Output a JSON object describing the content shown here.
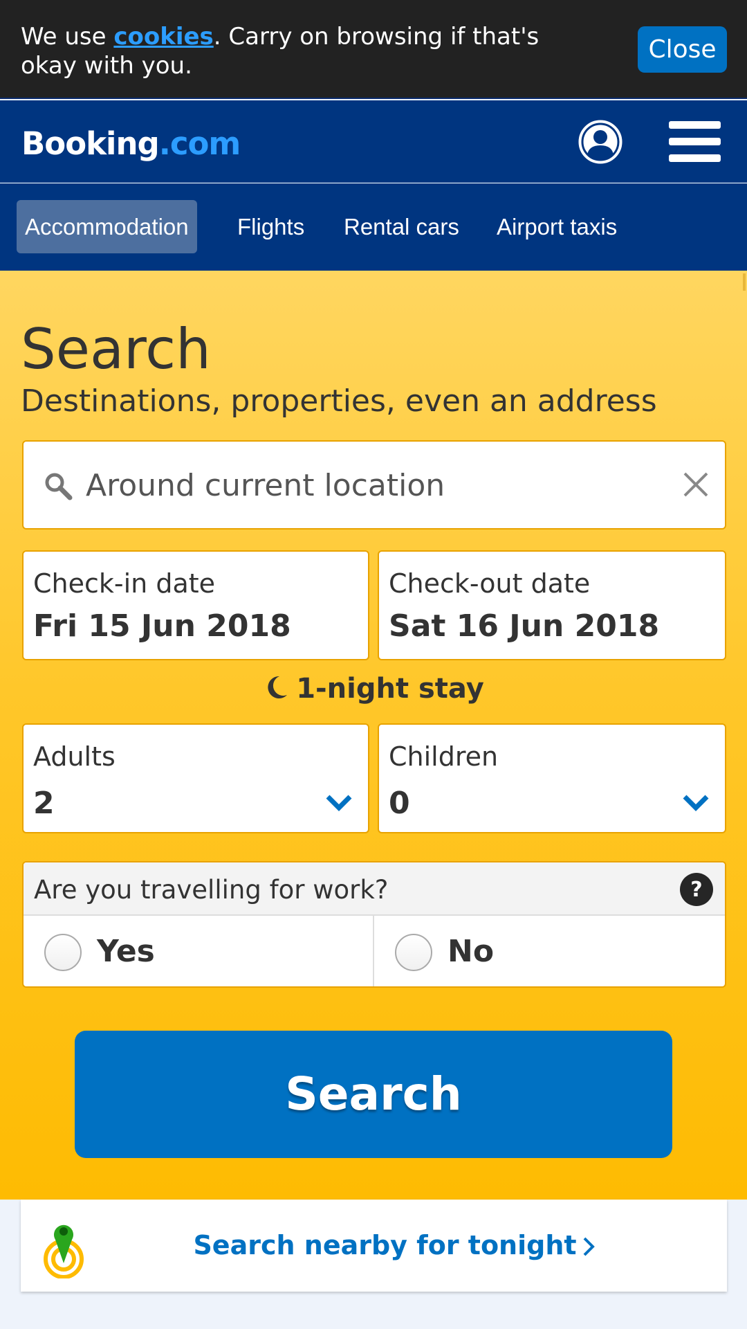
{
  "cookie_bar": {
    "text_before": "We use ",
    "link": "cookies",
    "text_after": ". Carry on browsing if that's okay with you.",
    "close_label": "Close"
  },
  "header": {
    "logo_main": "Booking",
    "logo_suffix": ".com",
    "account_icon": "user-circle-icon",
    "menu_icon": "hamburger-menu-icon"
  },
  "tabs": [
    {
      "label": "Accommodation",
      "active": true
    },
    {
      "label": "Flights",
      "active": false
    },
    {
      "label": "Rental cars",
      "active": false
    },
    {
      "label": "Airport taxis",
      "active": false
    }
  ],
  "search": {
    "title": "Search",
    "subtitle": "Destinations, properties, even an address",
    "destination_value": "Around current location"
  },
  "dates": {
    "checkin_label": "Check-in date",
    "checkin_value": "Fri 15 Jun 2018",
    "checkout_label": "Check-out date",
    "checkout_value": "Sat 16 Jun 2018",
    "stay_length": "1-night stay"
  },
  "guests": {
    "adults_label": "Adults",
    "adults_value": "2",
    "children_label": "Children",
    "children_value": "0"
  },
  "work": {
    "question": "Are you travelling for work?",
    "yes_label": "Yes",
    "no_label": "No"
  },
  "actions": {
    "search_button": "Search",
    "nearby_link": "Search nearby for tonight"
  },
  "colors": {
    "brand_navy": "#003580",
    "brand_blue": "#0071c2",
    "brand_yellow": "#febb02"
  }
}
